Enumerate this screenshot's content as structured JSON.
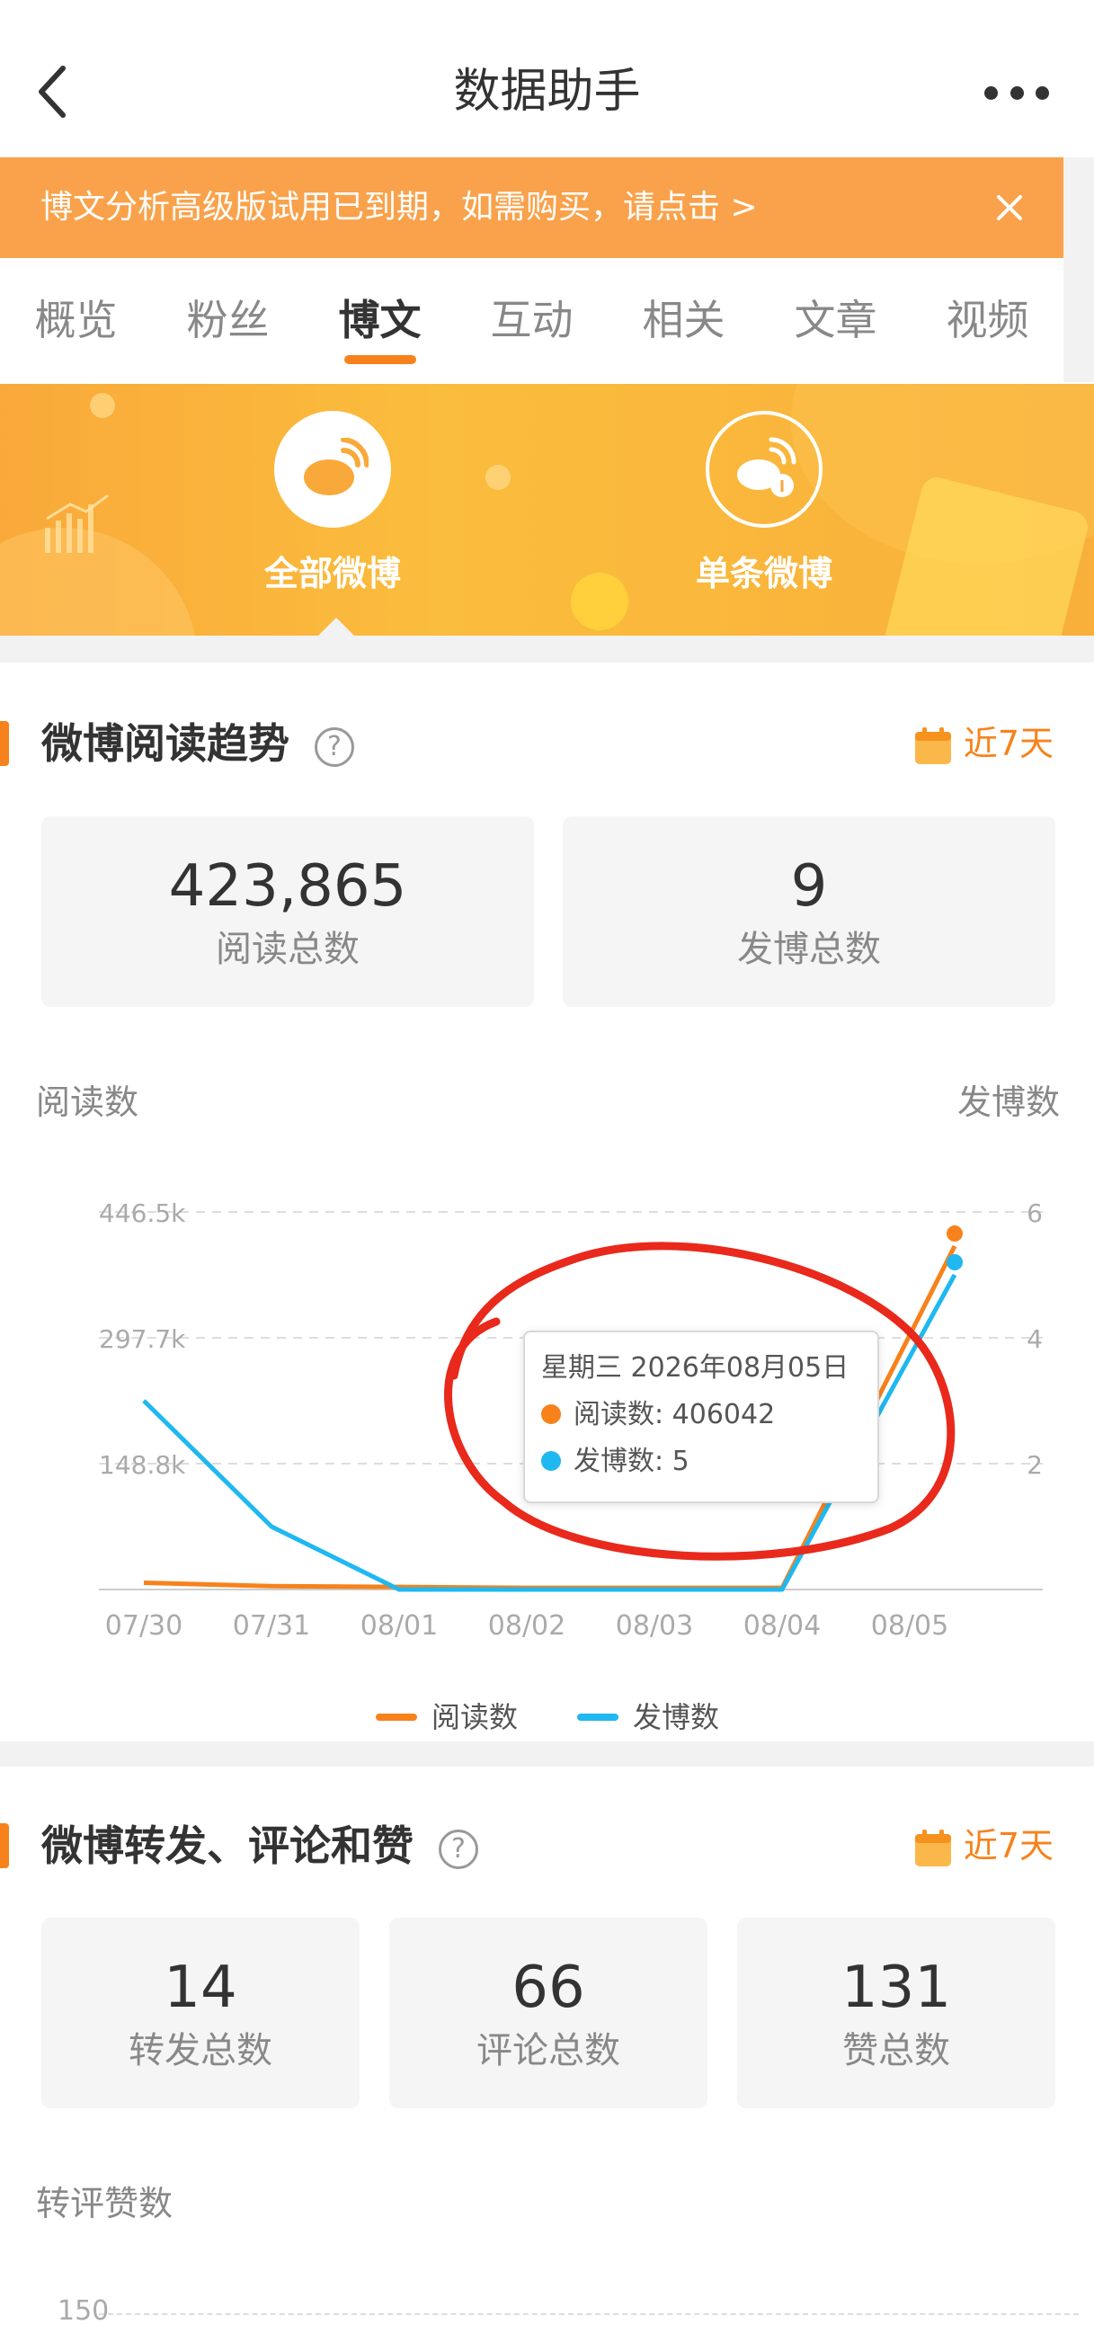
{
  "header": {
    "title": "数据助手",
    "back_icon": "back-arrow-icon",
    "more_icon": "more-dots-icon"
  },
  "notice": {
    "text": "博文分析高级版试用已到期，如需购买，请点击 >",
    "close_icon": "close-icon",
    "bg_color": "#f9a24b"
  },
  "tabs": [
    {
      "label": "概览",
      "active": false
    },
    {
      "label": "粉丝",
      "active": false
    },
    {
      "label": "博文",
      "active": true
    },
    {
      "label": "互动",
      "active": false
    },
    {
      "label": "相关",
      "active": false
    },
    {
      "label": "文章",
      "active": false
    },
    {
      "label": "视频",
      "active": false
    }
  ],
  "hero": {
    "items": [
      {
        "label": "全部微博",
        "icon": "weibo-logo-icon",
        "selected": true
      },
      {
        "label": "单条微博",
        "icon": "single-weibo-icon",
        "selected": false
      }
    ]
  },
  "reading_trend": {
    "title": "微博阅读趋势",
    "help_icon": "?",
    "period": "近7天",
    "cards": [
      {
        "value": "423,865",
        "label": "阅读总数"
      },
      {
        "value": "9",
        "label": "发博总数"
      }
    ],
    "left_axis_caption": "阅读数",
    "right_axis_caption": "发博数",
    "tooltip": {
      "title": "星期三 2026年08月05日",
      "line1": "阅读数: 406042",
      "line2": "发博数: 5"
    },
    "legend": {
      "series1": "阅读数",
      "series2": "发博数"
    },
    "colors": {
      "reads": "#f7821b",
      "posts": "#1fb8f0",
      "annotation": "#e8291c"
    }
  },
  "chart_data": {
    "type": "line",
    "x": [
      "07/30",
      "07/31",
      "08/01",
      "08/02",
      "08/03",
      "08/04",
      "08/05"
    ],
    "y_left_ticks": [
      "446.5k",
      "297.7k",
      "148.8k"
    ],
    "y_left_max": 446500,
    "y_right_ticks": [
      "6",
      "4",
      "2"
    ],
    "y_right_max": 6,
    "series": [
      {
        "name": "阅读数",
        "axis": "left",
        "values": [
          8000,
          4000,
          3000,
          2000,
          2000,
          2000,
          406042
        ]
      },
      {
        "name": "发博数",
        "axis": "right",
        "values": [
          3,
          1,
          0,
          0,
          0,
          0,
          5
        ]
      }
    ],
    "legend_position": "bottom",
    "grid": true
  },
  "interaction": {
    "title": "微博转发、评论和赞",
    "help_icon": "?",
    "period": "近7天",
    "cards": [
      {
        "value": "14",
        "label": "转发总数"
      },
      {
        "value": "66",
        "label": "评论总数"
      },
      {
        "value": "131",
        "label": "赞总数"
      }
    ],
    "axis_caption": "转评赞数",
    "top_tick": "150"
  }
}
